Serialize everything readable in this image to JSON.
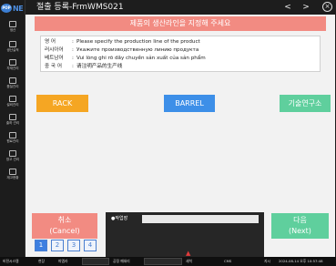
{
  "app": {
    "logo_badge": "POP",
    "logo_text": "NE",
    "title": "절출 등록-FrmWMS021",
    "nav_back": "<",
    "nav_forward": ">",
    "close": "×"
  },
  "sidebar": {
    "items": [
      {
        "label": "생산",
        "icon": "document-icon"
      },
      {
        "label": "생산실적",
        "icon": "list-icon"
      },
      {
        "label": "자재관리",
        "icon": "box-icon"
      },
      {
        "label": "품질관리",
        "icon": "check-icon"
      },
      {
        "label": "설비관리",
        "icon": "gear-icon"
      },
      {
        "label": "출하 관리",
        "icon": "truck-icon"
      },
      {
        "label": "원료관리",
        "icon": "barrel-icon"
      },
      {
        "label": "창고 관리",
        "icon": "warehouse-icon"
      },
      {
        "label": "재고현황",
        "icon": "chart-icon"
      }
    ]
  },
  "banner": "제품의 생산라인을 지정해 주세요",
  "info": {
    "rows": [
      {
        "lang": "영      어",
        "msg": "Please specify the production line of the product"
      },
      {
        "lang": "러시아어",
        "msg": "Укажите производственную линию продукта"
      },
      {
        "lang": "베트남어",
        "msg": "Vui lòng ghi rõ dây chuyền sản xuất của sản phẩm"
      },
      {
        "lang": "중 국 어",
        "msg": "请注明产品的生产线"
      }
    ]
  },
  "lines": {
    "rack": "RACK",
    "barrel": "BARREL",
    "lab": "기술연구소"
  },
  "actions": {
    "cancel_ko": "취소",
    "cancel_en": "(Cancel)",
    "next_ko": "다음",
    "next_en": "(Next)"
  },
  "work": {
    "label": "●작업장"
  },
  "pager": {
    "pages": [
      "1",
      "2",
      "3",
      "4"
    ],
    "active": "1"
  },
  "status": {
    "items": [
      "비젼시스템",
      "현장",
      "피엠라",
      "공정 폐쇄리",
      "세척",
      "CMS",
      "지시",
      "2024-08-14 오후 10:57:48"
    ]
  },
  "colors": {
    "rack": "#f5a623",
    "barrel": "#3d8fe8",
    "lab": "#5fcf9d",
    "cancel": "#f28b82",
    "banner": "#f28b82"
  }
}
